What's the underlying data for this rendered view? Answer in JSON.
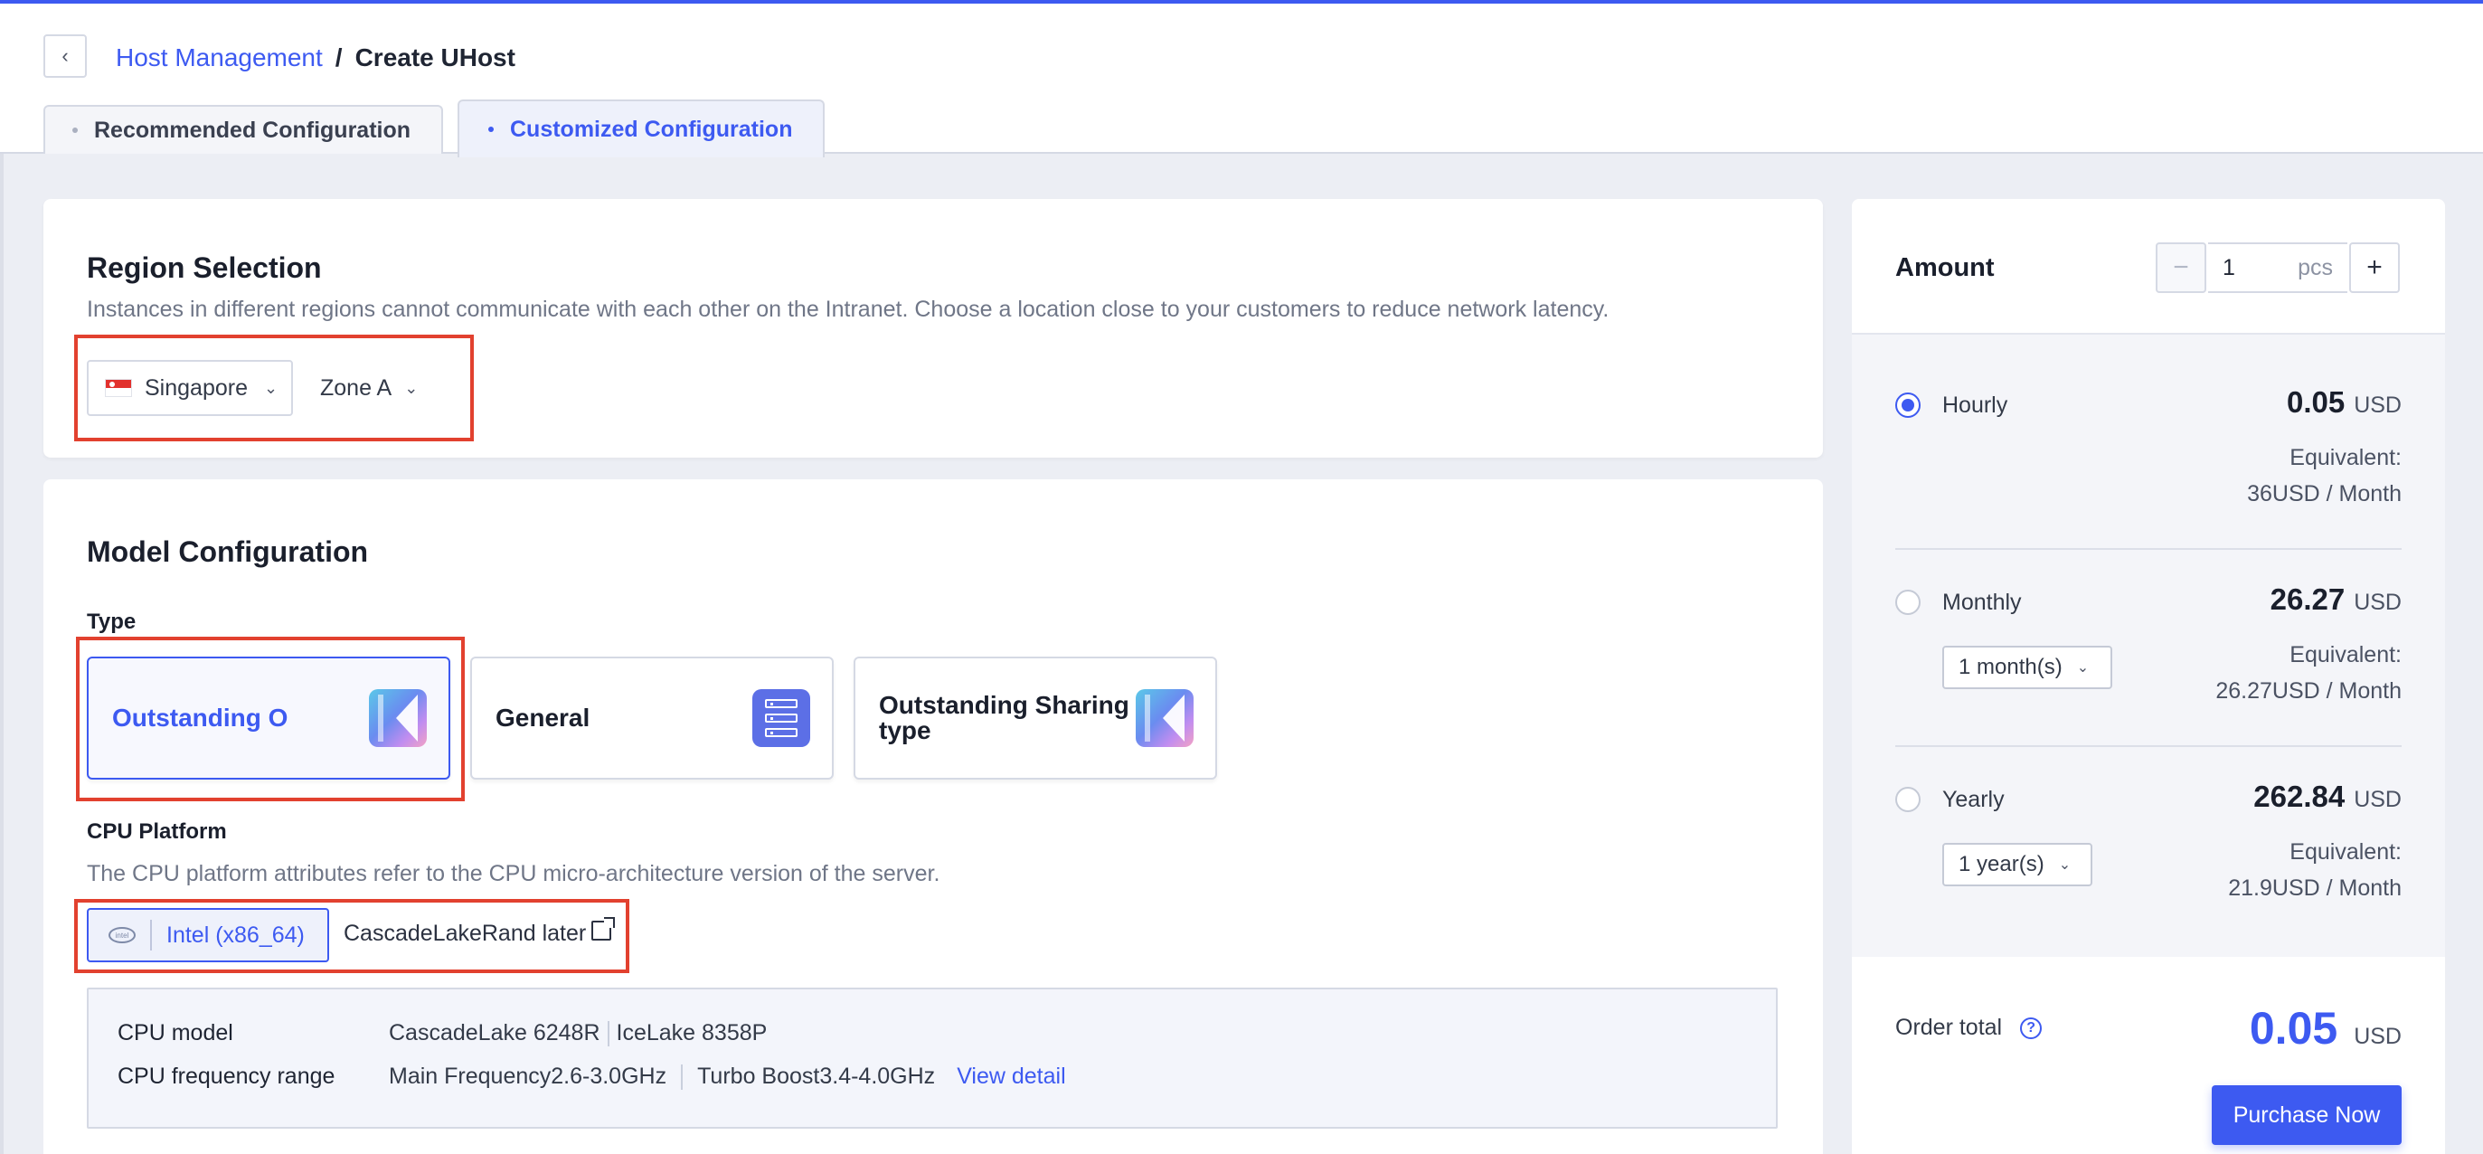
{
  "breadcrumb": {
    "parent": "Host Management",
    "separator": "/",
    "current": "Create UHost"
  },
  "tabs": {
    "recommended": "Recommended Configuration",
    "customized": "Customized Configuration",
    "active": "customized"
  },
  "region": {
    "title": "Region Selection",
    "description": "Instances in different regions cannot communicate with each other on the Intranet. Choose a location close to your customers to reduce network latency.",
    "country": "Singapore",
    "zone": "Zone A"
  },
  "model": {
    "title": "Model Configuration",
    "type_label": "Type",
    "types": [
      {
        "label": "Outstanding O",
        "icon": "outstanding-icon",
        "selected": true
      },
      {
        "label": "General",
        "icon": "server-icon",
        "selected": false
      },
      {
        "label": "Outstanding Sharing type",
        "icon": "outstanding-sharing-icon",
        "selected": false
      }
    ],
    "cpu_platform_label": "CPU Platform",
    "cpu_platform_desc": "The CPU platform attributes refer to the CPU micro-architecture version of the server.",
    "platform_button": "Intel (x86_64)",
    "platform_extra": "CascadeLakeRand later",
    "cpu_model_key": "CPU model",
    "cpu_model_values": [
      "CascadeLake 6248R",
      "IceLake 8358P"
    ],
    "cpu_freq_key": "CPU frequency range",
    "cpu_freq_values": [
      "Main Frequency2.6-3.0GHz",
      "Turbo Boost3.4-4.0GHz"
    ],
    "view_detail": "View detail"
  },
  "order": {
    "amount_label": "Amount",
    "quantity": "1",
    "unit": "pcs",
    "minus": "−",
    "plus": "+",
    "options": [
      {
        "name": "Hourly",
        "price": "0.05",
        "currency": "USD",
        "eq_label": "Equivalent:",
        "eq_value": "36USD / Month",
        "period": "",
        "selected": true
      },
      {
        "name": "Monthly",
        "price": "26.27",
        "currency": "USD",
        "eq_label": "Equivalent:",
        "eq_value": "26.27USD / Month",
        "period": "1 month(s)",
        "selected": false
      },
      {
        "name": "Yearly",
        "price": "262.84",
        "currency": "USD",
        "eq_label": "Equivalent:",
        "eq_value": "21.9USD / Month",
        "period": "1 year(s)",
        "selected": false
      }
    ],
    "total_label": "Order total",
    "total_value": "0.05",
    "total_currency": "USD",
    "purchase": "Purchase Now"
  },
  "colors": {
    "accent": "#3d5af1",
    "highlight_box": "#e2412f"
  }
}
